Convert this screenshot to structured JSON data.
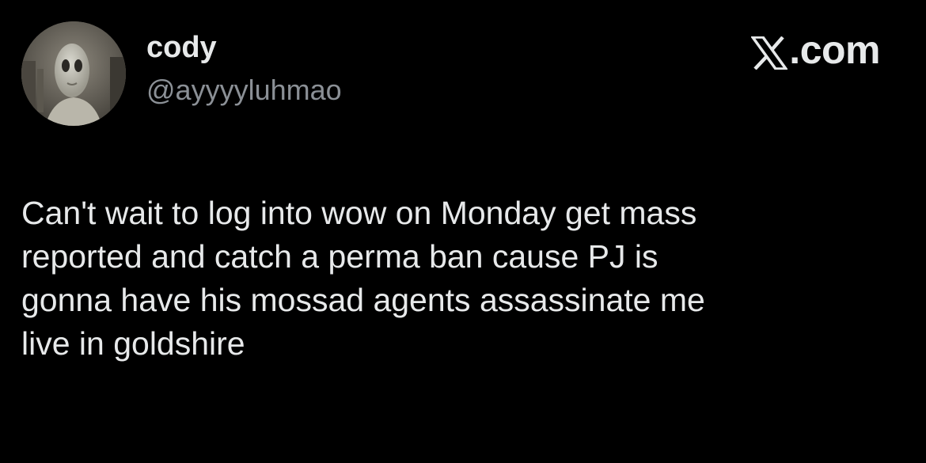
{
  "author": {
    "display_name": "cody",
    "handle": "@ayyyyluhmao",
    "avatar_icon": "alien-avatar-icon"
  },
  "brand": {
    "icon": "x-logo-icon",
    "text": ".com"
  },
  "tweet": {
    "text": "Can't wait to log into wow on Monday get mass\nreported and catch a perma ban cause PJ is\ngonna have his mossad agents assassinate me\nlive in goldshire"
  },
  "colors": {
    "background": "#000000",
    "primary_text": "#e7e9ea",
    "secondary_text": "#8b9096"
  }
}
